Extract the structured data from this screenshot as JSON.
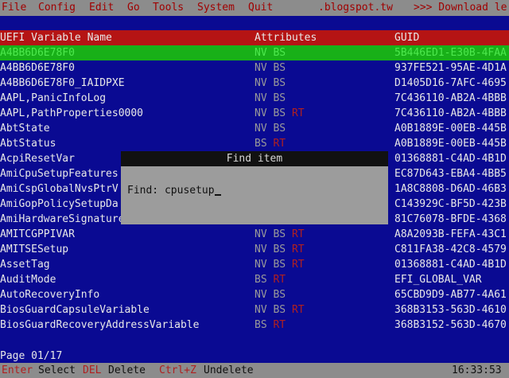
{
  "menu": {
    "items": [
      "File",
      "Config",
      "Edit",
      "Go",
      "Tools",
      "System",
      "Quit"
    ],
    "banner_left": ".blogspot.tw",
    "banner_right": ">>> Download le"
  },
  "table": {
    "headers": [
      "UEFI Variable Name",
      "Attributes",
      "GUID"
    ],
    "rows": [
      {
        "name": "A4BB6D6E78F0",
        "attrs": [
          "NV",
          "BS"
        ],
        "guid": "5B446ED1-E30B-4FAA",
        "selected": true
      },
      {
        "name": "A4BB6D6E78F0",
        "attrs": [
          "NV",
          "BS"
        ],
        "guid": "937FE521-95AE-4D1A"
      },
      {
        "name": "A4BB6D6E78F0_IAIDPXE",
        "attrs": [
          "NV",
          "BS"
        ],
        "guid": "D1405D16-7AFC-4695"
      },
      {
        "name": "AAPL,PanicInfoLog",
        "attrs": [
          "NV",
          "BS"
        ],
        "guid": "7C436110-AB2A-4BBB"
      },
      {
        "name": "AAPL,PathProperties0000",
        "attrs": [
          "NV",
          "BS",
          "RT"
        ],
        "guid": "7C436110-AB2A-4BBB"
      },
      {
        "name": "AbtState",
        "attrs": [
          "NV",
          "BS"
        ],
        "guid": "A0B1889E-00EB-445B"
      },
      {
        "name": "AbtStatus",
        "attrs": [
          "BS",
          "RT"
        ],
        "guid": "A0B1889E-00EB-445B"
      },
      {
        "name": "AcpiResetVar",
        "attrs": [
          "",
          ""
        ],
        "guid": "01368881-C4AD-4B1D"
      },
      {
        "name": "AmiCpuSetupFeatures",
        "attrs": [
          "",
          ""
        ],
        "guid": "EC87D643-EBA4-4BB5"
      },
      {
        "name": "AmiCspGlobalNvsPtrV",
        "attrs": [
          "",
          ""
        ],
        "guid": "1A8C8808-D6AD-46B3"
      },
      {
        "name": "AmiGopPolicySetupDa",
        "attrs": [
          "",
          ""
        ],
        "guid": "C143929C-BF5D-423B"
      },
      {
        "name": "AmiHardwareSignatureSetupUpdateCountVar",
        "attrs": [
          "NV",
          "BS",
          "RT"
        ],
        "guid": "81C76078-BFDE-4368",
        "bright": true
      },
      {
        "name": "AMITCGPPIVAR",
        "attrs": [
          "NV",
          "BS",
          "RT"
        ],
        "guid": "A8A2093B-FEFA-43C1"
      },
      {
        "name": "AMITSESetup",
        "attrs": [
          "NV",
          "BS",
          "RT"
        ],
        "guid": "C811FA38-42C8-4579"
      },
      {
        "name": "AssetTag",
        "attrs": [
          "NV",
          "BS",
          "RT"
        ],
        "guid": "01368881-C4AD-4B1D"
      },
      {
        "name": "AuditMode",
        "attrs": [
          "BS",
          "RT"
        ],
        "guid": "EFI_GLOBAL_VAR"
      },
      {
        "name": "AutoRecoveryInfo",
        "attrs": [
          "NV",
          "BS"
        ],
        "guid": "65CBD9D9-AB77-4A61"
      },
      {
        "name": "BiosGuardCapsuleVariable",
        "attrs": [
          "NV",
          "BS",
          "RT"
        ],
        "guid": "368B3153-563D-4610"
      },
      {
        "name": "BiosGuardRecoveryAddressVariable",
        "attrs": [
          "BS",
          "RT"
        ],
        "guid": "368B3152-563D-4670"
      }
    ]
  },
  "dialog": {
    "title": "Find item",
    "label": "Find:",
    "value": "cpusetup"
  },
  "page_indicator": "Page 01/17",
  "statusbar": {
    "enter_key": "Enter",
    "enter_label": "Select",
    "del_key": "DEL",
    "del_label": "Delete",
    "undelete_key": "Ctrl+Z",
    "undelete_label": "Undelete",
    "clock": "16:33:53"
  },
  "colors": {
    "background": "#0a0a92",
    "menubar": "#8c8c8c",
    "header": "#b51414",
    "selection": "#18b018",
    "attr_rt": "#b02020"
  }
}
